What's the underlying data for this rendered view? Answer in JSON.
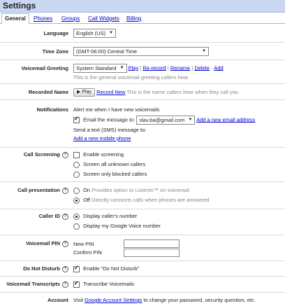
{
  "title": "Settings",
  "tabs": [
    {
      "label": "General"
    },
    {
      "label": "Phones"
    },
    {
      "label": "Groups"
    },
    {
      "label": "Call Widgets"
    },
    {
      "label": "Billing"
    }
  ],
  "language": {
    "label": "Language",
    "value": "English (US)"
  },
  "timezone": {
    "label": "Time Zone",
    "value": "(GMT-06:00) Central Time"
  },
  "voicemail_greeting": {
    "label": "Voicemail Greeting",
    "value": "System Standard",
    "actions": [
      "Play",
      "Re-record",
      "Rename",
      "Delete",
      "Add"
    ],
    "hint": "This is the general voicemail greeting callers hear"
  },
  "recorded_name": {
    "label": "Recorded Name",
    "play": "Play",
    "record_new": "Record New",
    "hint": "This is the name callers hear when they call you"
  },
  "notifications": {
    "label": "Notifications",
    "alert": "Alert me when I have new voicemails",
    "email_label": "Email the message to:",
    "email_value": "slav.ba@gmail.com",
    "add_email": "Add a new email address",
    "sms_label": "Send a text (SMS) message to:",
    "add_mobile": "Add a new mobile phone"
  },
  "call_screening": {
    "label": "Call Screening",
    "enable": "Enable screening",
    "opt1": "Screen all unknown callers",
    "opt2": "Screen only blocked callers"
  },
  "call_presentation": {
    "label": "Call presentation",
    "on": "On",
    "on_hint": "Provides option to ListenIn™ on voicemail",
    "off": "Off",
    "off_hint": "Directly connects calls when phones are answered"
  },
  "caller_id": {
    "label": "Caller ID",
    "opt1": "Display caller's number",
    "opt2": "Display my Google Voice number"
  },
  "voicemail_pin": {
    "label": "Voicemail PIN",
    "new": "New PIN",
    "confirm": "Confirm PIN"
  },
  "dnd": {
    "label": "Do Not Disturb",
    "option": "Enable \"Do Not Disturb\""
  },
  "transcripts": {
    "label": "Voicemail Transcripts",
    "option": "Transcribe Voicemails"
  },
  "account": {
    "label": "Account",
    "prefix": "Visit",
    "link": "Google Account Settings",
    "suffix": "to change your password, security question, etc."
  }
}
